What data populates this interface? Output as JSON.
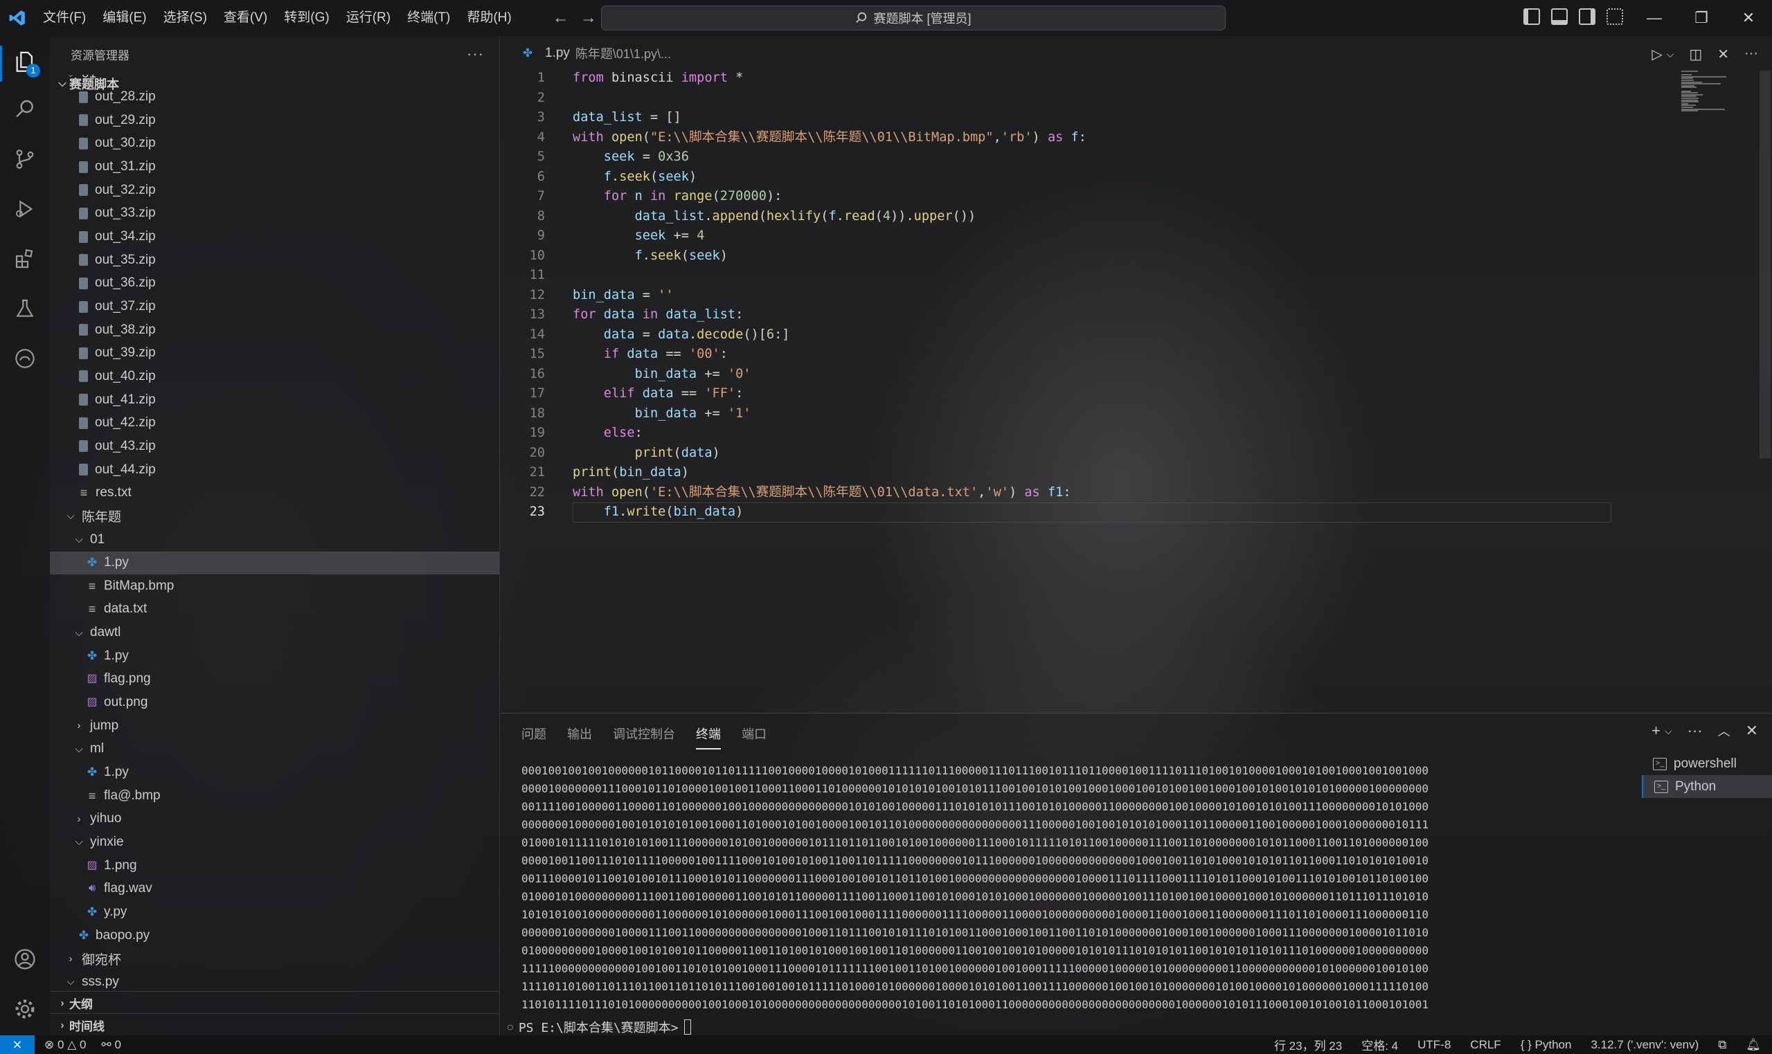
{
  "titlebar": {
    "menus": [
      "文件(F)",
      "编辑(E)",
      "选择(S)",
      "查看(V)",
      "转到(G)",
      "运行(R)",
      "终端(T)",
      "帮助(H)"
    ],
    "search_text": "赛题脚本 [管理员]"
  },
  "activity": {
    "explorer_badge": "1"
  },
  "explorer": {
    "title": "资源管理器",
    "root": "赛题脚本",
    "rows": [
      {
        "label": "01",
        "type": "folder-open",
        "depth": 1
      },
      {
        "label": "out_28.zip",
        "type": "zip",
        "depth": 2
      },
      {
        "label": "out_29.zip",
        "type": "zip",
        "depth": 2
      },
      {
        "label": "out_30.zip",
        "type": "zip",
        "depth": 2
      },
      {
        "label": "out_31.zip",
        "type": "zip",
        "depth": 2
      },
      {
        "label": "out_32.zip",
        "type": "zip",
        "depth": 2
      },
      {
        "label": "out_33.zip",
        "type": "zip",
        "depth": 2
      },
      {
        "label": "out_34.zip",
        "type": "zip",
        "depth": 2
      },
      {
        "label": "out_35.zip",
        "type": "zip",
        "depth": 2
      },
      {
        "label": "out_36.zip",
        "type": "zip",
        "depth": 2
      },
      {
        "label": "out_37.zip",
        "type": "zip",
        "depth": 2
      },
      {
        "label": "out_38.zip",
        "type": "zip",
        "depth": 2
      },
      {
        "label": "out_39.zip",
        "type": "zip",
        "depth": 2
      },
      {
        "label": "out_40.zip",
        "type": "zip",
        "depth": 2
      },
      {
        "label": "out_41.zip",
        "type": "zip",
        "depth": 2
      },
      {
        "label": "out_42.zip",
        "type": "zip",
        "depth": 2
      },
      {
        "label": "out_43.zip",
        "type": "zip",
        "depth": 2
      },
      {
        "label": "out_44.zip",
        "type": "zip",
        "depth": 2
      },
      {
        "label": "res.txt",
        "type": "txt",
        "depth": 2
      },
      {
        "label": "陈年题",
        "type": "folder-open",
        "depth": 1
      },
      {
        "label": "01",
        "type": "folder-open",
        "depth": 2
      },
      {
        "label": "1.py",
        "type": "py",
        "depth": 3,
        "selected": true
      },
      {
        "label": "BitMap.bmp",
        "type": "txt",
        "depth": 3
      },
      {
        "label": "data.txt",
        "type": "txt",
        "depth": 3
      },
      {
        "label": "dawtl",
        "type": "folder-open",
        "depth": 2
      },
      {
        "label": "1.py",
        "type": "py",
        "depth": 3
      },
      {
        "label": "flag.png",
        "type": "img",
        "depth": 3
      },
      {
        "label": "out.png",
        "type": "img",
        "depth": 3
      },
      {
        "label": "jump",
        "type": "folder-closed",
        "depth": 2
      },
      {
        "label": "ml",
        "type": "folder-open",
        "depth": 2
      },
      {
        "label": "1.py",
        "type": "py",
        "depth": 3
      },
      {
        "label": "fla@.bmp",
        "type": "txt",
        "depth": 3
      },
      {
        "label": "yihuo",
        "type": "folder-closed",
        "depth": 2
      },
      {
        "label": "yinxie",
        "type": "folder-open",
        "depth": 2
      },
      {
        "label": "1.png",
        "type": "img",
        "depth": 3
      },
      {
        "label": "flag.wav",
        "type": "wav",
        "depth": 3
      },
      {
        "label": "y.py",
        "type": "py",
        "depth": 3
      },
      {
        "label": "baopo.py",
        "type": "py",
        "depth": 2
      },
      {
        "label": "御宛杯",
        "type": "folder-closed",
        "depth": 1
      },
      {
        "label": "sss.py",
        "type": "folder-open",
        "depth": 1
      }
    ],
    "outline_label": "大纲",
    "timeline_label": "时间线"
  },
  "tab": {
    "filename": "1.py",
    "path": "陈年题\\01\\1.py\\..."
  },
  "code": [
    [
      [
        "kw",
        "from"
      ],
      [
        "plain",
        " binascii "
      ],
      [
        "kw",
        "import"
      ],
      [
        "plain",
        " *"
      ]
    ],
    [],
    [
      [
        "var",
        "data_list"
      ],
      [
        "plain",
        " = []"
      ]
    ],
    [
      [
        "kw",
        "with"
      ],
      [
        "plain",
        " "
      ],
      [
        "fn",
        "open"
      ],
      [
        "plain",
        "("
      ],
      [
        "str",
        "\"E:\\\\脚本合集\\\\赛题脚本\\\\陈年题\\\\01\\\\BitMap.bmp\""
      ],
      [
        "plain",
        ","
      ],
      [
        "str",
        "'rb'"
      ],
      [
        "plain",
        ") "
      ],
      [
        "kw",
        "as"
      ],
      [
        "plain",
        " "
      ],
      [
        "var",
        "f"
      ],
      [
        "plain",
        ":"
      ]
    ],
    [
      [
        "plain",
        "    "
      ],
      [
        "var",
        "seek"
      ],
      [
        "plain",
        " = "
      ],
      [
        "num",
        "0x36"
      ]
    ],
    [
      [
        "plain",
        "    "
      ],
      [
        "var",
        "f"
      ],
      [
        "plain",
        "."
      ],
      [
        "fn",
        "seek"
      ],
      [
        "plain",
        "("
      ],
      [
        "var",
        "seek"
      ],
      [
        "plain",
        ")"
      ]
    ],
    [
      [
        "plain",
        "    "
      ],
      [
        "kw",
        "for"
      ],
      [
        "plain",
        " "
      ],
      [
        "var",
        "n"
      ],
      [
        "plain",
        " "
      ],
      [
        "kw",
        "in"
      ],
      [
        "plain",
        " "
      ],
      [
        "fn",
        "range"
      ],
      [
        "plain",
        "("
      ],
      [
        "num",
        "270000"
      ],
      [
        "plain",
        "):"
      ]
    ],
    [
      [
        "plain",
        "        "
      ],
      [
        "var",
        "data_list"
      ],
      [
        "plain",
        "."
      ],
      [
        "fn",
        "append"
      ],
      [
        "plain",
        "("
      ],
      [
        "fn",
        "hexlify"
      ],
      [
        "plain",
        "("
      ],
      [
        "var",
        "f"
      ],
      [
        "plain",
        "."
      ],
      [
        "fn",
        "read"
      ],
      [
        "plain",
        "("
      ],
      [
        "num",
        "4"
      ],
      [
        "plain",
        "))."
      ],
      [
        "fn",
        "upper"
      ],
      [
        "plain",
        "())"
      ]
    ],
    [
      [
        "plain",
        "        "
      ],
      [
        "var",
        "seek"
      ],
      [
        "plain",
        " += "
      ],
      [
        "num",
        "4"
      ]
    ],
    [
      [
        "plain",
        "        "
      ],
      [
        "var",
        "f"
      ],
      [
        "plain",
        "."
      ],
      [
        "fn",
        "seek"
      ],
      [
        "plain",
        "("
      ],
      [
        "var",
        "seek"
      ],
      [
        "plain",
        ")"
      ]
    ],
    [],
    [
      [
        "var",
        "bin_data"
      ],
      [
        "plain",
        " = "
      ],
      [
        "str",
        "''"
      ]
    ],
    [
      [
        "kw",
        "for"
      ],
      [
        "plain",
        " "
      ],
      [
        "var",
        "data"
      ],
      [
        "plain",
        " "
      ],
      [
        "kw",
        "in"
      ],
      [
        "plain",
        " "
      ],
      [
        "var",
        "data_list"
      ],
      [
        "plain",
        ":"
      ]
    ],
    [
      [
        "plain",
        "    "
      ],
      [
        "var",
        "data"
      ],
      [
        "plain",
        " = "
      ],
      [
        "var",
        "data"
      ],
      [
        "plain",
        "."
      ],
      [
        "fn",
        "decode"
      ],
      [
        "plain",
        "()["
      ],
      [
        "num",
        "6"
      ],
      [
        "plain",
        ":]"
      ]
    ],
    [
      [
        "plain",
        "    "
      ],
      [
        "kw",
        "if"
      ],
      [
        "plain",
        " "
      ],
      [
        "var",
        "data"
      ],
      [
        "plain",
        " == "
      ],
      [
        "str",
        "'00'"
      ],
      [
        "plain",
        ":"
      ]
    ],
    [
      [
        "plain",
        "        "
      ],
      [
        "var",
        "bin_data"
      ],
      [
        "plain",
        " += "
      ],
      [
        "str",
        "'0'"
      ]
    ],
    [
      [
        "plain",
        "    "
      ],
      [
        "kw",
        "elif"
      ],
      [
        "plain",
        " "
      ],
      [
        "var",
        "data"
      ],
      [
        "plain",
        " == "
      ],
      [
        "str",
        "'FF'"
      ],
      [
        "plain",
        ":"
      ]
    ],
    [
      [
        "plain",
        "        "
      ],
      [
        "var",
        "bin_data"
      ],
      [
        "plain",
        " += "
      ],
      [
        "str",
        "'1'"
      ]
    ],
    [
      [
        "plain",
        "    "
      ],
      [
        "kw",
        "else"
      ],
      [
        "plain",
        ":"
      ]
    ],
    [
      [
        "plain",
        "        "
      ],
      [
        "fn",
        "print"
      ],
      [
        "plain",
        "("
      ],
      [
        "var",
        "data"
      ],
      [
        "plain",
        ")"
      ]
    ],
    [
      [
        "fn",
        "print"
      ],
      [
        "plain",
        "("
      ],
      [
        "var",
        "bin_data"
      ],
      [
        "plain",
        ")"
      ]
    ],
    [
      [
        "kw",
        "with"
      ],
      [
        "plain",
        " "
      ],
      [
        "fn",
        "open"
      ],
      [
        "plain",
        "("
      ],
      [
        "str",
        "'E:\\\\脚本合集\\\\赛题脚本\\\\陈年题\\\\01\\\\data.txt'"
      ],
      [
        "plain",
        ","
      ],
      [
        "str",
        "'w'"
      ],
      [
        "plain",
        ") "
      ],
      [
        "kw",
        "as"
      ],
      [
        "plain",
        " "
      ],
      [
        "var",
        "f1"
      ],
      [
        "plain",
        ":"
      ]
    ],
    [
      [
        "plain",
        "    "
      ],
      [
        "var",
        "f1"
      ],
      [
        "plain",
        "."
      ],
      [
        "fn",
        "write"
      ],
      [
        "plain",
        "("
      ],
      [
        "var",
        "bin_data"
      ],
      [
        "plain",
        ")"
      ]
    ]
  ],
  "current_line": 23,
  "panel": {
    "tabs": [
      "问题",
      "输出",
      "调试控制台",
      "终端",
      "端口"
    ],
    "active_tab": "终端",
    "terminal_lines": [
      "00010010010010000001011000010110111110010000100001010001111110111000001110111001011101100001001111011101001010000100010100100010010010001000000",
      "00001000000011100010110100001001001100011000110100000010101010100101011100100101010010001000100101001001000100101001010101000001000000000000000",
      "00111100100000110000110100000010010000000000000001010100100000111010101011100101010000011000000001001000010100101010011100000000101010001001000",
      "00000001000000100101010101001000110100010100100001001011010000000000000000011100000100100101010100011011000001100100000100010000000101111101100",
      "01000101111101010101001110000001010010000001011101101100101001000000111000101111101011001000001110011010000000101011000110011010000001000000001",
      "00001001100111010111100000100111100010100101001100110111110000000010111000000100000000000000100010011010100010101011011000110101010100100010111",
      "00111000010110010100101110001010110000000111000100100101101101001000000000000000000100001110111100011110101100010100111010100101101001001001001",
      "01000101000000000111001100100000110010101100000111100110001100101000101010001000000010000010011101001001000010001010000001101110111010101000111",
      "10101010010000000000110000001010000001000111001001000111100000011110000011000010000000000100001100010001100000001110110100001110000001100000100",
      "00000010000000100001110011000000000000000010001101110010101110101001100010001001100110101000000010001001000000100011100000001000010110101100110",
      "01000000000100001001010010110000011001101001010001001001101000000110010010010100000101010111010101011001010101101011101000000100000000001101110",
      "11111000000000000100100110101010010001110000101111111001001101001000000100100011111000001000001010000000001100000000000101000000100101000000000",
      "11110110100110111011001101101011100100100101111101000101000000100001010100110011110000001001001010000000101001000010100000010001111101001100110",
      "11010111101110101000000000010010001010000000000000000000010100110101000110000000000000000000000000100000010101110001001010010110001010010101101"
    ],
    "prompt": "PS E:\\脚本合集\\赛题脚本>",
    "sessions": [
      {
        "label": "powershell",
        "active": false
      },
      {
        "label": "Python",
        "active": true
      }
    ]
  },
  "status": {
    "errors": "0",
    "warnings": "0",
    "ports": "0",
    "position": "行 23，列 23",
    "spaces": "空格: 4",
    "encoding": "UTF-8",
    "eol": "CRLF",
    "language": "Python",
    "interpreter": "3.12.7 ('.venv': venv)"
  }
}
